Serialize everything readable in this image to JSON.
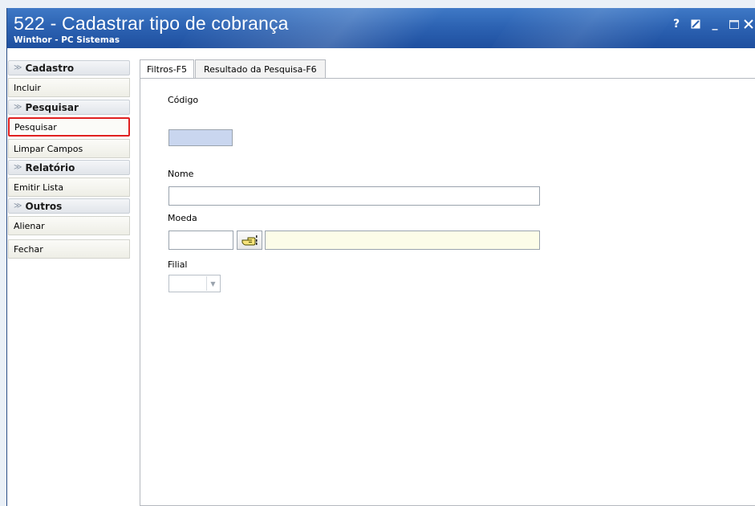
{
  "window": {
    "title": "522 - Cadastrar tipo de cobrança",
    "subtitle": "Winthor - PC Sistemas",
    "controls": {
      "help": "?",
      "minimize": "_"
    }
  },
  "sidebar": {
    "sections": [
      {
        "title": "Cadastro",
        "items": [
          "Incluir"
        ]
      },
      {
        "title": "Pesquisar",
        "items": [
          "Pesquisar",
          "Limpar Campos"
        ]
      },
      {
        "title": "Relatório",
        "items": [
          "Emitir Lista"
        ]
      },
      {
        "title": "Outros",
        "items": [
          "Alienar",
          "Fechar"
        ]
      }
    ],
    "highlighted_item": "Pesquisar"
  },
  "tabs": [
    {
      "label": "Filtros-F5",
      "active": true
    },
    {
      "label": "Resultado da Pesquisa-F6",
      "active": false
    }
  ],
  "form": {
    "codigo": {
      "label": "Código",
      "value": ""
    },
    "nome": {
      "label": "Nome",
      "value": ""
    },
    "moeda": {
      "label": "Moeda",
      "value": "",
      "description": ""
    },
    "filial": {
      "label": "Filial",
      "value": ""
    }
  },
  "colors": {
    "titlebar": "#2d63b3",
    "highlight_border": "#e02020",
    "codigo_field_bg": "#c9d6ef",
    "desc_field_bg": "#fcfce8"
  },
  "icons": {
    "lookup": "pointing-hand-icon",
    "section_toggle": "double-chevron-down-icon"
  }
}
